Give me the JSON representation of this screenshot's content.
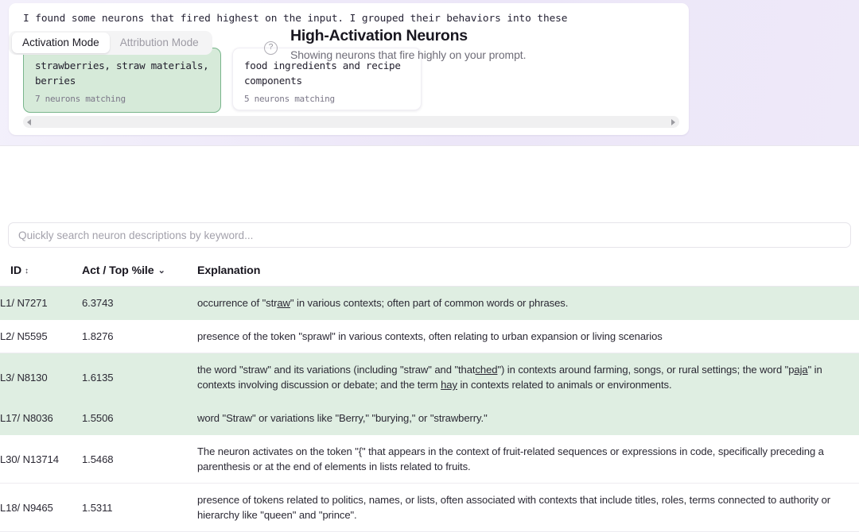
{
  "message": {
    "body": "I found some neurons that fired highest on the input. I grouped their behaviors into these\nclusters:",
    "clusters": [
      {
        "title": "strawberries, straw\nmaterials, berries",
        "count_label": "7 neurons matching",
        "selected": true
      },
      {
        "title": "food ingredients and\nrecipe components",
        "count_label": "5 neurons matching",
        "selected": false
      }
    ],
    "scroll_left_icon": "chevron-left-icon",
    "scroll_right_icon": "chevron-right-icon"
  },
  "controls": {
    "modes": [
      {
        "label": "Activation Mode",
        "active": true
      },
      {
        "label": "Attribution Mode",
        "active": false
      }
    ],
    "help_icon": "?",
    "title": "High-Activation Neurons",
    "subtitle": "Showing neurons that fire highly on your prompt."
  },
  "search": {
    "placeholder": "Quickly search neuron descriptions by keyword...",
    "value": ""
  },
  "table": {
    "columns": [
      {
        "label": "ID",
        "sort_icon": "sort-updown-icon"
      },
      {
        "label": "Act / Top %ile",
        "sort_icon": "chevron-down-icon"
      },
      {
        "label": "Explanation",
        "sort_icon": ""
      }
    ],
    "rows": [
      {
        "id": "L1/ N7271",
        "act": "6.3743",
        "explanation_html": "occurrence of \"str<u>aw</u>\" in various contexts; often part of common words or phrases.",
        "highlighted": true
      },
      {
        "id": "L2/ N5595",
        "act": "1.8276",
        "explanation_html": "presence of the token \"sprawl\" in various contexts, often relating to urban expansion or living scenarios",
        "highlighted": false
      },
      {
        "id": "L3/ N8130",
        "act": "1.6135",
        "explanation_html": "the word \"straw\" and its variations (including \"straw\" and \"that<u>ched</u>\") in contexts around farming, songs, or rural settings; the word \"p<u>aja</u>\" in contexts involving discussion or debate; and the term <u>hay</u> in contexts related to animals or environments.",
        "highlighted": true
      },
      {
        "id": "L17/ N8036",
        "act": "1.5506",
        "explanation_html": "word \"Straw\" or variations like \"Berry,\" \"burying,\" or \"strawberry.\"",
        "highlighted": true
      },
      {
        "id": "L30/ N13714",
        "act": "1.5468",
        "explanation_html": "The neuron activates on the token \"{\" that appears in the context of fruit-related sequences or expressions in code, specifically preceding a parenthesis or at the end of elements in lists related to fruits.",
        "highlighted": false
      },
      {
        "id": "L18/ N9465",
        "act": "1.5311",
        "explanation_html": "presence of tokens related to politics, names, or lists, often associated with contexts that include titles, roles, terms connected to authority or hierarchy like \"queen\" and \"prince\".",
        "highlighted": false
      }
    ]
  },
  "colors": {
    "highlight_row": "#dfeee2",
    "selected_card_bg": "#d6ead9",
    "selected_card_border": "#79b58c",
    "panel_bg": "#ece6f8"
  }
}
